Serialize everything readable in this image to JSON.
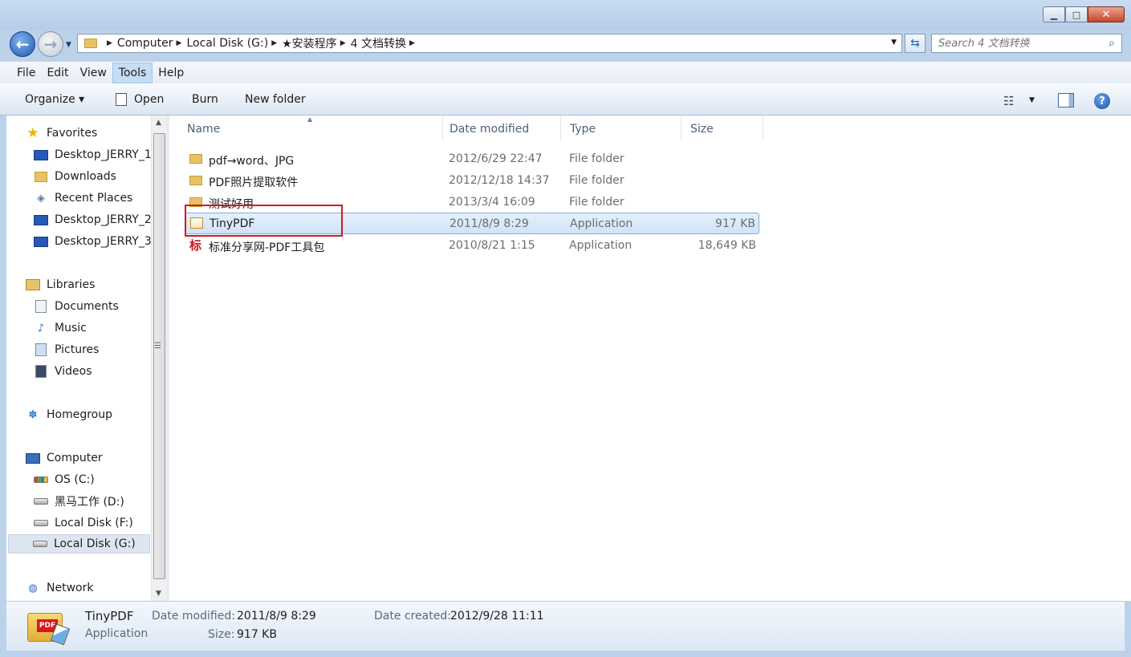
{
  "window": {
    "minimize_glyph": "▁",
    "maximize_glyph": "□",
    "close_glyph": "✕"
  },
  "address": {
    "crumbs": [
      "Computer",
      "Local Disk (G:)",
      "★安装程序",
      "4 文档转换"
    ]
  },
  "search": {
    "placeholder": "Search 4 文档转换"
  },
  "menu": [
    "File",
    "Edit",
    "View",
    "Tools",
    "Help"
  ],
  "toolbar": {
    "organize": "Organize ▾",
    "open": "Open",
    "burn": "Burn",
    "new_folder": "New folder"
  },
  "sidebar": {
    "favorites": "Favorites",
    "favorites_items": [
      "Desktop_JERRY_1",
      "Downloads",
      "Recent Places",
      "Desktop_JERRY_2",
      "Desktop_JERRY_3"
    ],
    "libraries": "Libraries",
    "libraries_items": [
      "Documents",
      "Music",
      "Pictures",
      "Videos"
    ],
    "homegroup": "Homegroup",
    "computer": "Computer",
    "computer_items": [
      "OS (C:)",
      "黑马工作 (D:)",
      "Local Disk (F:)",
      "Local Disk (G:)"
    ],
    "network": "Network"
  },
  "columns": {
    "name": "Name",
    "date": "Date modified",
    "type": "Type",
    "size": "Size"
  },
  "files": [
    {
      "name": "pdf→word、JPG",
      "date": "2012/6/29 22:47",
      "type": "File folder",
      "size": ""
    },
    {
      "name": "PDF照片提取软件",
      "date": "2012/12/18 14:37",
      "type": "File folder",
      "size": ""
    },
    {
      "name": "测试好用",
      "date": "2013/3/4 16:09",
      "type": "File folder",
      "size": ""
    },
    {
      "name": "TinyPDF",
      "date": "2011/8/9 8:29",
      "type": "Application",
      "size": "917 KB"
    },
    {
      "name": "标准分享网-PDF工具包",
      "date": "2010/8/21 1:15",
      "type": "Application",
      "size": "18,649 KB"
    }
  ],
  "details": {
    "name": "TinyPDF",
    "type": "Application",
    "date_modified_label": "Date modified:",
    "date_modified": "2011/8/9 8:29",
    "size_label": "Size:",
    "size": "917 KB",
    "date_created_label": "Date created:",
    "date_created": "2012/9/28 11:11"
  }
}
